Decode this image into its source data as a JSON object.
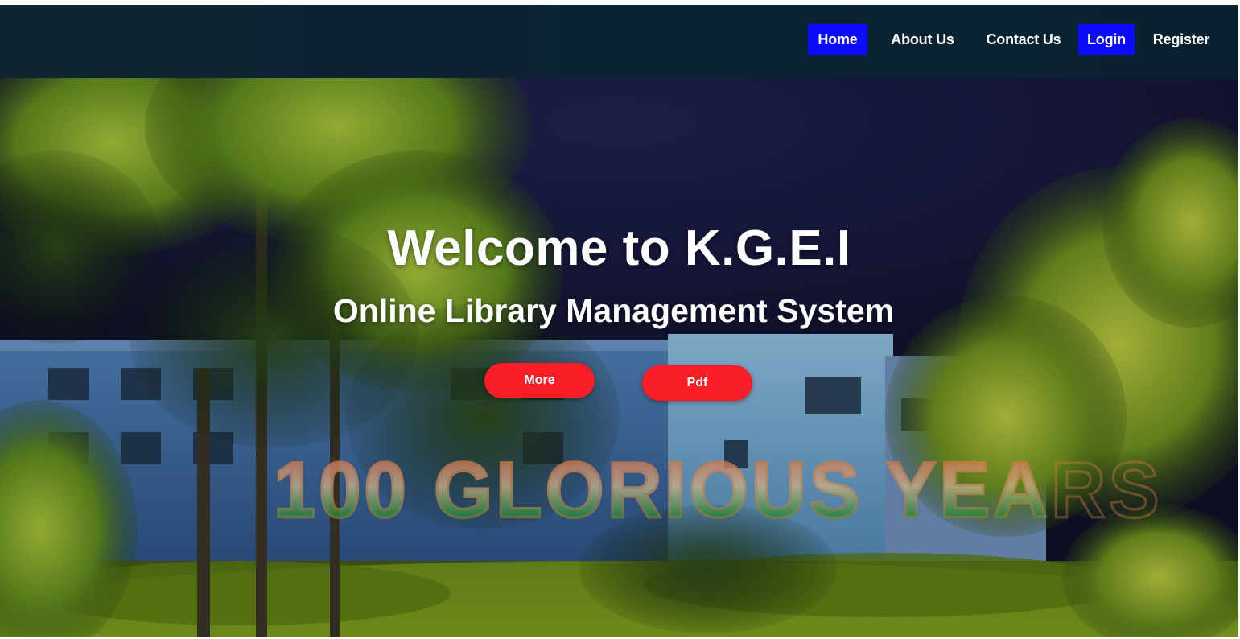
{
  "nav": {
    "items": [
      {
        "label": "Home",
        "active": true
      },
      {
        "label": "About Us",
        "active": false
      },
      {
        "label": "Contact Us",
        "active": false
      },
      {
        "label": "Login",
        "active": true
      },
      {
        "label": "Register",
        "active": false
      }
    ]
  },
  "hero": {
    "title": "Welcome to K.G.E.I",
    "subtitle": "Online Library Management System",
    "buttons": {
      "more_label": "More",
      "pdf_label": "Pdf"
    },
    "banner_text": "100 GLORIOUS YEARS"
  },
  "colors": {
    "navbar_bg": "#0b2433",
    "nav_active_bg": "#0a0bff",
    "button_bg": "#f81d26",
    "text": "#ffffff"
  }
}
